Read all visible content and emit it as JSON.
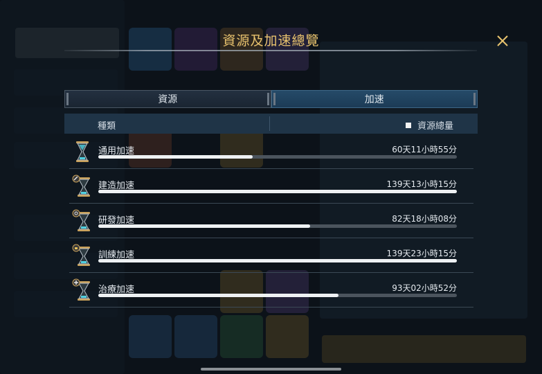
{
  "header": {
    "title": "資源及加速總覽"
  },
  "tabs": [
    {
      "label": "資源",
      "active": false
    },
    {
      "label": "加速",
      "active": true
    }
  ],
  "columns": {
    "type_label": "種類",
    "total_label": "資源總量"
  },
  "items": [
    {
      "name": "通用加速",
      "time": "60天11小時55分",
      "progress": 0.43,
      "icon": "hourglass-icon"
    },
    {
      "name": "建造加速",
      "time": "139天13小時15分",
      "progress": 1.0,
      "icon": "hourglass-hammer-icon"
    },
    {
      "name": "研發加速",
      "time": "82天18小時08分",
      "progress": 0.59,
      "icon": "hourglass-research-icon"
    },
    {
      "name": "訓練加速",
      "time": "139天23小時15分",
      "progress": 1.0,
      "icon": "hourglass-training-icon"
    },
    {
      "name": "治療加速",
      "time": "93天02小時52分",
      "progress": 0.67,
      "icon": "hourglass-healing-icon"
    }
  ],
  "colors": {
    "accent_gold": "#e9c36e",
    "active_tab": "#1c3b56",
    "bar_fill": "#eef1f3"
  }
}
